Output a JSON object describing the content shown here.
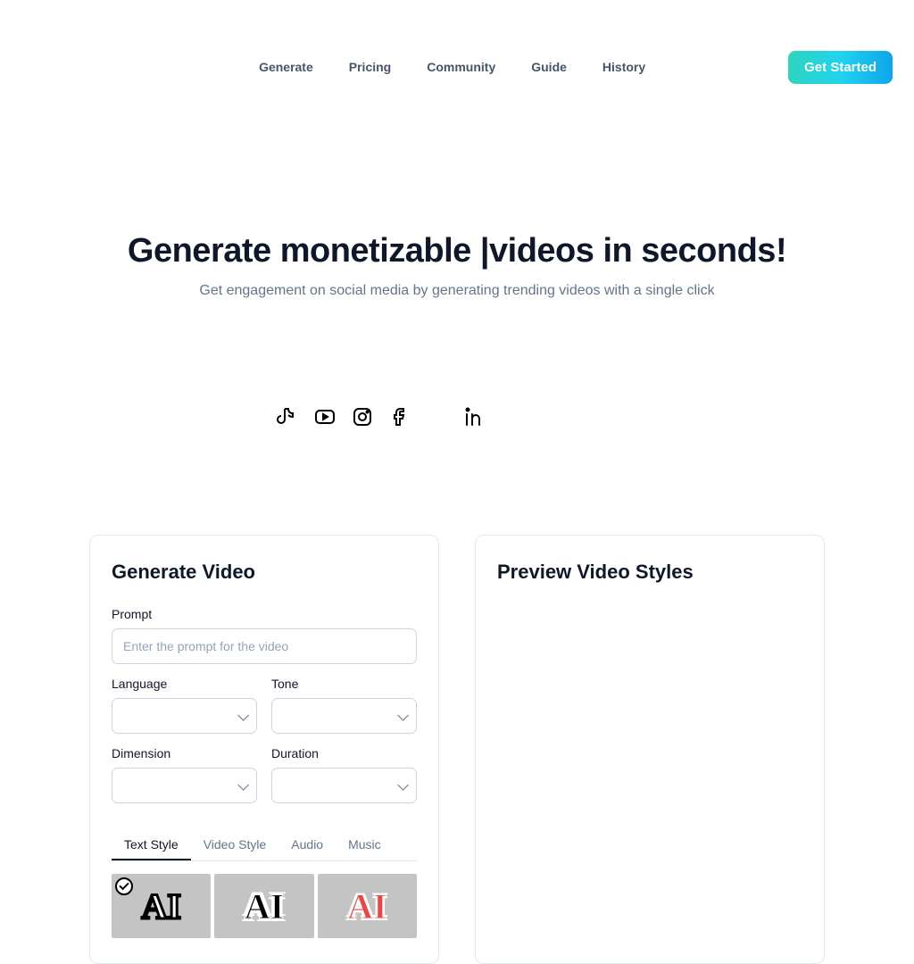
{
  "nav": {
    "items": [
      "Generate",
      "Pricing",
      "Community",
      "Guide",
      "History"
    ],
    "cta": "Get Started"
  },
  "hero": {
    "title_prefix": "Generate monetizable |",
    "title_suffix": "videos in seconds!",
    "subtitle": "Get engagement on social media by generating trending videos with a single click"
  },
  "social_icons": [
    "tiktok",
    "youtube",
    "instagram",
    "facebook",
    "linkedin"
  ],
  "generate_card": {
    "title": "Generate Video",
    "prompt_label": "Prompt",
    "prompt_placeholder": "Enter the prompt for the video",
    "language_label": "Language",
    "tone_label": "Tone",
    "dimension_label": "Dimension",
    "duration_label": "Duration",
    "tabs": [
      "Text Style",
      "Video Style",
      "Audio",
      "Music"
    ],
    "active_tab": 0,
    "style_samples": [
      "AI",
      "AI",
      "AI"
    ]
  },
  "preview_card": {
    "title": "Preview Video Styles"
  }
}
